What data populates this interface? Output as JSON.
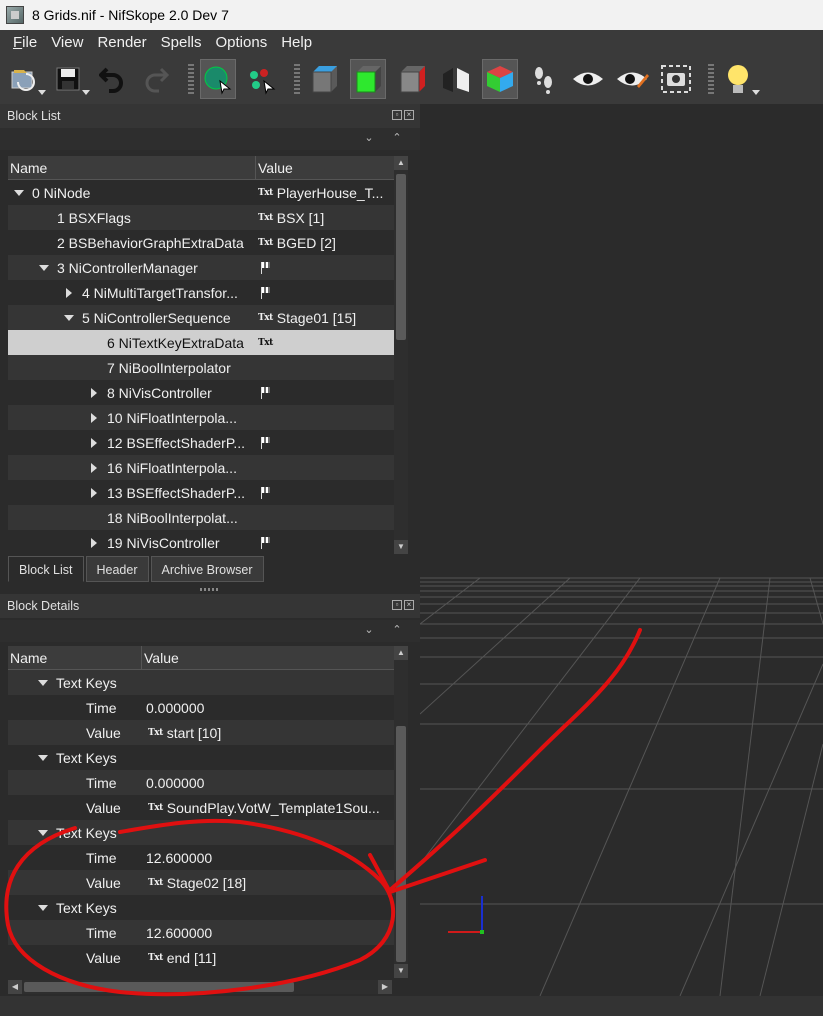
{
  "window": {
    "title": "8 Grids.nif - NifSkope 2.0 Dev 7"
  },
  "menu": {
    "items": [
      {
        "label": "File",
        "mnemonic": "F",
        "rest": "ile"
      },
      {
        "label": "View"
      },
      {
        "label": "Render"
      },
      {
        "label": "Spells"
      },
      {
        "label": "Options"
      },
      {
        "label": "Help"
      }
    ]
  },
  "toolbar": {
    "icons": [
      "open-icon",
      "save-icon",
      "undo-icon",
      "redo-icon",
      "select-icon",
      "select-vertex-icon",
      "cube-front-icon",
      "cube-top-icon",
      "cube-side-icon",
      "cube-flip-icon",
      "cube-perspective-icon",
      "walk-icon",
      "view-icon",
      "view-edit-icon",
      "screenshot-icon",
      "light-bulb-icon"
    ]
  },
  "block_list": {
    "title": "Block List",
    "columns": {
      "name": "Name",
      "value": "Value"
    },
    "rows": [
      {
        "name": "0 NiNode",
        "value": "PlayerHouse_T...",
        "txt": true,
        "flag": false,
        "arrow": "open",
        "indent": 0,
        "sel": false
      },
      {
        "name": "1 BSXFlags",
        "value": "BSX [1]",
        "txt": true,
        "flag": false,
        "arrow": "",
        "indent": 1,
        "sel": false
      },
      {
        "name": "2 BSBehaviorGraphExtraData",
        "value": "BGED [2]",
        "txt": true,
        "flag": false,
        "arrow": "",
        "indent": 1,
        "sel": false
      },
      {
        "name": "3 NiControllerManager",
        "value": "",
        "txt": false,
        "flag": true,
        "arrow": "open",
        "indent": 1,
        "sel": false
      },
      {
        "name": "4 NiMultiTargetTransfor...",
        "value": "",
        "txt": false,
        "flag": true,
        "arrow": "closed",
        "indent": 2,
        "sel": false
      },
      {
        "name": "5 NiControllerSequence",
        "value": "Stage01 [15]",
        "txt": true,
        "flag": false,
        "arrow": "open",
        "indent": 2,
        "sel": false
      },
      {
        "name": "6 NiTextKeyExtraData",
        "value": "",
        "txt": true,
        "flag": false,
        "arrow": "",
        "indent": 3,
        "sel": true
      },
      {
        "name": "7 NiBoolInterpolator",
        "value": "",
        "txt": false,
        "flag": false,
        "arrow": "",
        "indent": 3,
        "sel": false
      },
      {
        "name": "8 NiVisController",
        "value": "",
        "txt": false,
        "flag": true,
        "arrow": "closed",
        "indent": 3,
        "sel": false
      },
      {
        "name": "10 NiFloatInterpola...",
        "value": "",
        "txt": false,
        "flag": false,
        "arrow": "closed",
        "indent": 3,
        "sel": false
      },
      {
        "name": "12 BSEffectShaderP...",
        "value": "",
        "txt": false,
        "flag": true,
        "arrow": "closed",
        "indent": 3,
        "sel": false
      },
      {
        "name": "16 NiFloatInterpola...",
        "value": "",
        "txt": false,
        "flag": false,
        "arrow": "closed",
        "indent": 3,
        "sel": false
      },
      {
        "name": "13 BSEffectShaderP...",
        "value": "",
        "txt": false,
        "flag": true,
        "arrow": "closed",
        "indent": 3,
        "sel": false
      },
      {
        "name": "18 NiBoolInterpolat...",
        "value": "",
        "txt": false,
        "flag": false,
        "arrow": "",
        "indent": 3,
        "sel": false
      },
      {
        "name": "19 NiVisController",
        "value": "",
        "txt": false,
        "flag": true,
        "arrow": "closed",
        "indent": 3,
        "sel": false
      }
    ]
  },
  "tabs": [
    {
      "label": "Block List",
      "active": true
    },
    {
      "label": "Header",
      "active": false
    },
    {
      "label": "Archive Browser",
      "active": false
    }
  ],
  "block_details": {
    "title": "Block Details",
    "columns": {
      "name": "Name",
      "value": "Value"
    },
    "rows": [
      {
        "name": "Text Keys",
        "value": "",
        "txt": false,
        "arrow": "open",
        "indent": 1
      },
      {
        "name": "Time",
        "value": "0.000000",
        "txt": false,
        "arrow": "",
        "indent": 2
      },
      {
        "name": "Value",
        "value": "start [10]",
        "txt": true,
        "arrow": "",
        "indent": 2
      },
      {
        "name": "Text Keys",
        "value": "",
        "txt": false,
        "arrow": "open",
        "indent": 1
      },
      {
        "name": "Time",
        "value": "0.000000",
        "txt": false,
        "arrow": "",
        "indent": 2
      },
      {
        "name": "Value",
        "value": "SoundPlay.VotW_Template1Sou...",
        "txt": true,
        "arrow": "",
        "indent": 2
      },
      {
        "name": "Text Keys",
        "value": "",
        "txt": false,
        "arrow": "open",
        "indent": 1
      },
      {
        "name": "Time",
        "value": "12.600000",
        "txt": false,
        "arrow": "",
        "indent": 2
      },
      {
        "name": "Value",
        "value": "Stage02 [18]",
        "txt": true,
        "arrow": "",
        "indent": 2
      },
      {
        "name": "Text Keys",
        "value": "",
        "txt": false,
        "arrow": "open",
        "indent": 1
      },
      {
        "name": "Time",
        "value": "12.600000",
        "txt": false,
        "arrow": "",
        "indent": 2
      },
      {
        "name": "Value",
        "value": "end [11]",
        "txt": true,
        "arrow": "",
        "indent": 2
      }
    ]
  },
  "labels": {
    "txt_badge": "Txt"
  },
  "colors": {
    "annotation": "#e01010",
    "background": "#2b2b2b",
    "selection": "#cfcfcf"
  }
}
